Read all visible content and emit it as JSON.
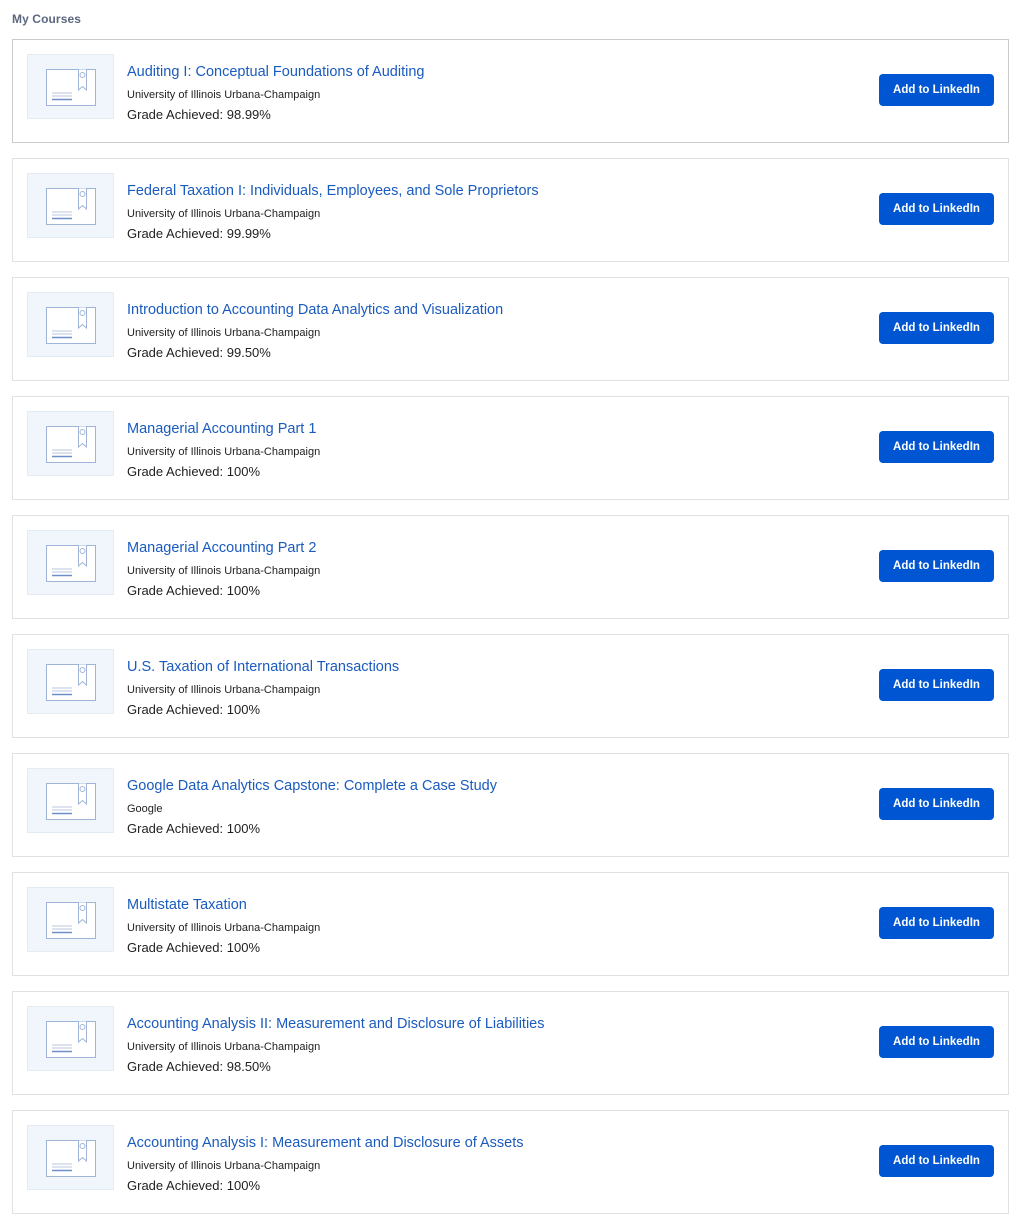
{
  "section_title": "My Courses",
  "button_label": "Add to LinkedIn",
  "grade_prefix": "Grade Achieved:",
  "colors": {
    "link": "#1a5bbf",
    "button": "#0056d2",
    "thumbnail_bg": "#f0f6fc",
    "section_title": "#5b6780"
  },
  "thumbnail_icon": "certificate-icon",
  "courses": [
    {
      "title": "Auditing I: Conceptual Foundations of Auditing",
      "partner": "University of Illinois Urbana-Champaign",
      "grade": "98.99%"
    },
    {
      "title": "Federal Taxation I: Individuals, Employees, and Sole Proprietors",
      "partner": "University of Illinois Urbana-Champaign",
      "grade": "99.99%"
    },
    {
      "title": "Introduction to Accounting Data Analytics and Visualization",
      "partner": "University of Illinois Urbana-Champaign",
      "grade": "99.50%"
    },
    {
      "title": "Managerial Accounting Part 1",
      "partner": "University of Illinois Urbana-Champaign",
      "grade": "100%"
    },
    {
      "title": "Managerial Accounting Part 2",
      "partner": "University of Illinois Urbana-Champaign",
      "grade": "100%"
    },
    {
      "title": "U.S. Taxation of International Transactions",
      "partner": "University of Illinois Urbana-Champaign",
      "grade": "100%"
    },
    {
      "title": "Google Data Analytics Capstone: Complete a Case Study",
      "partner": "Google",
      "grade": "100%"
    },
    {
      "title": "Multistate Taxation",
      "partner": "University of Illinois Urbana-Champaign",
      "grade": "100%"
    },
    {
      "title": "Accounting Analysis II: Measurement and Disclosure of Liabilities",
      "partner": "University of Illinois Urbana-Champaign",
      "grade": "98.50%"
    },
    {
      "title": "Accounting Analysis I: Measurement and Disclosure of Assets",
      "partner": "University of Illinois Urbana-Champaign",
      "grade": "100%"
    }
  ]
}
